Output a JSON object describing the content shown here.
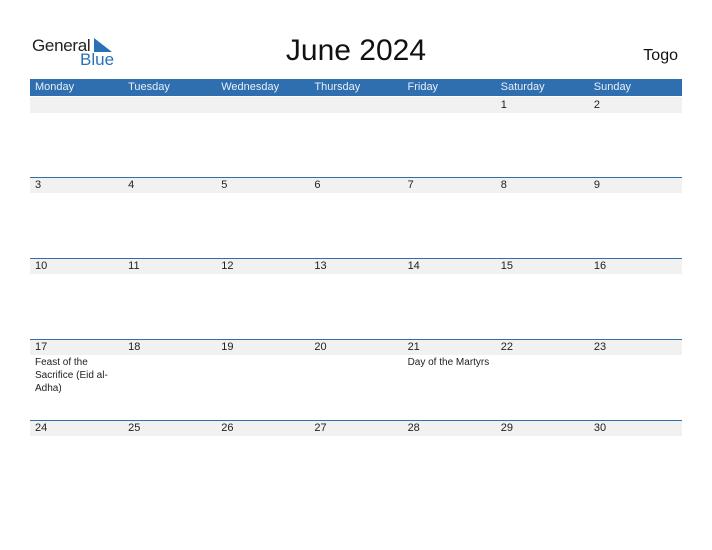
{
  "logo": {
    "line1": "General",
    "line2": "Blue"
  },
  "title": "June 2024",
  "country": "Togo",
  "weekdays": [
    "Monday",
    "Tuesday",
    "Wednesday",
    "Thursday",
    "Friday",
    "Saturday",
    "Sunday"
  ],
  "weeks": [
    {
      "days": [
        {
          "num": "",
          "event": ""
        },
        {
          "num": "",
          "event": ""
        },
        {
          "num": "",
          "event": ""
        },
        {
          "num": "",
          "event": ""
        },
        {
          "num": "",
          "event": ""
        },
        {
          "num": "1",
          "event": ""
        },
        {
          "num": "2",
          "event": ""
        }
      ]
    },
    {
      "days": [
        {
          "num": "3",
          "event": ""
        },
        {
          "num": "4",
          "event": ""
        },
        {
          "num": "5",
          "event": ""
        },
        {
          "num": "6",
          "event": ""
        },
        {
          "num": "7",
          "event": ""
        },
        {
          "num": "8",
          "event": ""
        },
        {
          "num": "9",
          "event": ""
        }
      ]
    },
    {
      "days": [
        {
          "num": "10",
          "event": ""
        },
        {
          "num": "11",
          "event": ""
        },
        {
          "num": "12",
          "event": ""
        },
        {
          "num": "13",
          "event": ""
        },
        {
          "num": "14",
          "event": ""
        },
        {
          "num": "15",
          "event": ""
        },
        {
          "num": "16",
          "event": ""
        }
      ]
    },
    {
      "days": [
        {
          "num": "17",
          "event": "Feast of the Sacrifice (Eid al-Adha)"
        },
        {
          "num": "18",
          "event": ""
        },
        {
          "num": "19",
          "event": ""
        },
        {
          "num": "20",
          "event": ""
        },
        {
          "num": "21",
          "event": "Day of the Martyrs"
        },
        {
          "num": "22",
          "event": ""
        },
        {
          "num": "23",
          "event": ""
        }
      ]
    },
    {
      "days": [
        {
          "num": "24",
          "event": ""
        },
        {
          "num": "25",
          "event": ""
        },
        {
          "num": "26",
          "event": ""
        },
        {
          "num": "27",
          "event": ""
        },
        {
          "num": "28",
          "event": ""
        },
        {
          "num": "29",
          "event": ""
        },
        {
          "num": "30",
          "event": ""
        }
      ]
    }
  ]
}
